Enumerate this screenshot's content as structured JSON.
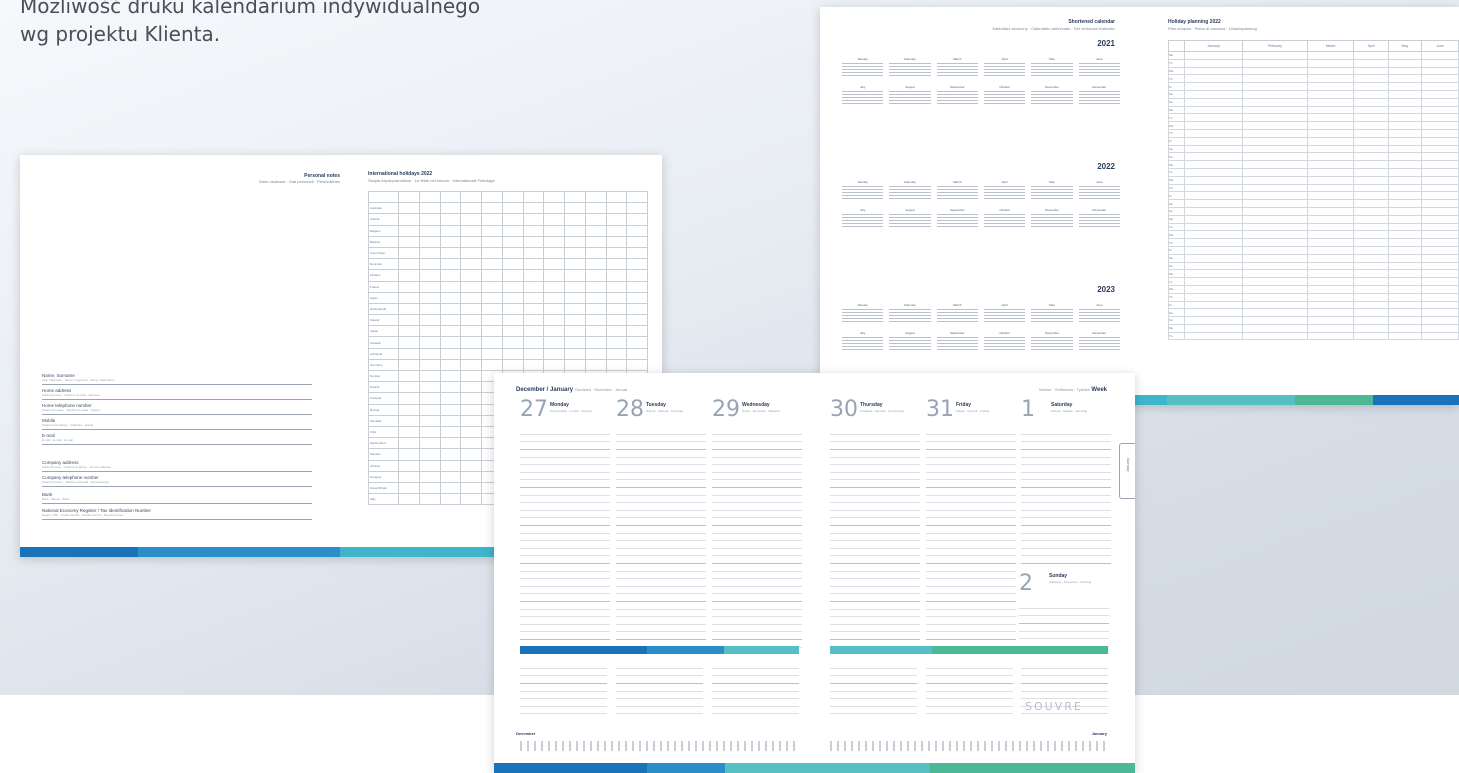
{
  "headline": {
    "line1": "Możliwość druku kalendarium indywidualnego",
    "line2": "wg projektu Klienta."
  },
  "spread_personal": {
    "left_title": "Personal notes",
    "left_subtitle": "Dane osobowe · Dati personali · Persönliches",
    "fields": [
      {
        "label": "Name, Surname",
        "sub": "Imię, Nazwisko · Nome, Cognome · Name, Nachname"
      },
      {
        "label": "Home address",
        "sub": "Adres domowy · Indirizzo di casa · Adresse"
      },
      {
        "label": "Home telephone number",
        "sub": "Telefon domowy · Telefono di casa · Telefon"
      },
      {
        "label": "Mobile",
        "sub": "Telefon komórkowy · Cellulare · Handy"
      },
      {
        "label": "E-mail",
        "sub": "E-mail · E-mail · E-mail"
      },
      {
        "label": "Company address",
        "sub": "Adres firmowy · Indirizzo di lavoro · Firmen-Adresse"
      },
      {
        "label": "Company telephone number",
        "sub": "Telefon firmowy · Telefono azienda · Firmentelefon"
      },
      {
        "label": "Bank",
        "sub": "Bank · Banca · Bank"
      },
      {
        "label": "National Economy Register / Tax Identification Number",
        "sub": "Regon / NIP · Codice fiscale · Partita iva IVA · Steuernummer"
      }
    ],
    "right_title": "International holidays 2022",
    "right_subtitle": "Święta międzynarodowe · Le feste nel mondo · Internationale Feiertage",
    "countries": [
      "Australia",
      "Austria",
      "Belgium",
      "Belarus",
      "Czech Rep.",
      "Denmark",
      "Finland",
      "France",
      "Spain",
      "Netherlands",
      "Ireland",
      "Japan",
      "Canada",
      "Lithuania",
      "Germany",
      "Norway",
      "Poland",
      "Portugal",
      "Russia",
      "Slovakia",
      "USA",
      "Switzerland",
      "Sweden",
      "Ukraine",
      "Hungary",
      "Great Britain",
      "Italy"
    ]
  },
  "spread_calendar": {
    "left_title": "Shortened calendar",
    "left_subtitle": "Kalendarz skrócony · Calendario abbreviato · Der verkürzte Kalender",
    "years": [
      "2021",
      "2022",
      "2023"
    ],
    "months": [
      "January",
      "February",
      "March",
      "April",
      "May",
      "June",
      "July",
      "August",
      "September",
      "October",
      "November",
      "December"
    ],
    "right_title": "Holiday planning 2022",
    "right_subtitle": "Plan urlopów · Piano di vacanza · Urlaubsplanung",
    "columns": [
      "January",
      "February",
      "March",
      "April",
      "May",
      "June"
    ],
    "weekdays": [
      "Mo",
      "Tu",
      "We",
      "Th",
      "Fr",
      "Sa",
      "Su",
      "Mo",
      "Tu",
      "We",
      "Th",
      "Fr",
      "Sa",
      "Su",
      "Mo",
      "Tu",
      "We",
      "Th",
      "Fr",
      "Sa",
      "Su",
      "Mo",
      "Tu",
      "We",
      "Th",
      "Fr",
      "Sa",
      "Su",
      "Mo",
      "Tu",
      "We",
      "Th",
      "Fr",
      "Sa",
      "Su",
      "Mo",
      "Tu"
    ]
  },
  "spread_weekly": {
    "header_month": "December / January",
    "header_sub": "Grudzień · Dicembre · Januar",
    "header_right_sub": "Woche · Settimana · Tydzień",
    "header_right": "Week",
    "days_left": [
      {
        "num": "27",
        "name": "Monday",
        "sub": "Poniedziałek · Lunedì · Montag"
      },
      {
        "num": "28",
        "name": "Tuesday",
        "sub": "Wtorek · Martedì · Dienstag"
      },
      {
        "num": "29",
        "name": "Wednesday",
        "sub": "Środa · Mercoledì · Mittwoch"
      }
    ],
    "days_right": [
      {
        "num": "30",
        "name": "Thursday",
        "sub": "Czwartek · Giovedì · Donnerstag"
      },
      {
        "num": "31",
        "name": "Friday",
        "sub": "Piątek · Venerdì · Freitag"
      },
      {
        "num": "1",
        "name": "Saturday",
        "sub": "Sobota · Sabato · Samstag"
      }
    ],
    "sunday": {
      "num": "2",
      "name": "Sunday",
      "sub": "Niedziela · Domenica · Sonntag"
    },
    "logo": "SOUVRE",
    "tab_label": "January",
    "mini_left": "December",
    "mini_right": "January"
  },
  "colors": {
    "stripe1": "#1a72b8",
    "stripe2": "#2a8fc9",
    "stripe3": "#3fb5cb",
    "stripe4": "#55bfc4",
    "stripe5": "#4db896"
  }
}
